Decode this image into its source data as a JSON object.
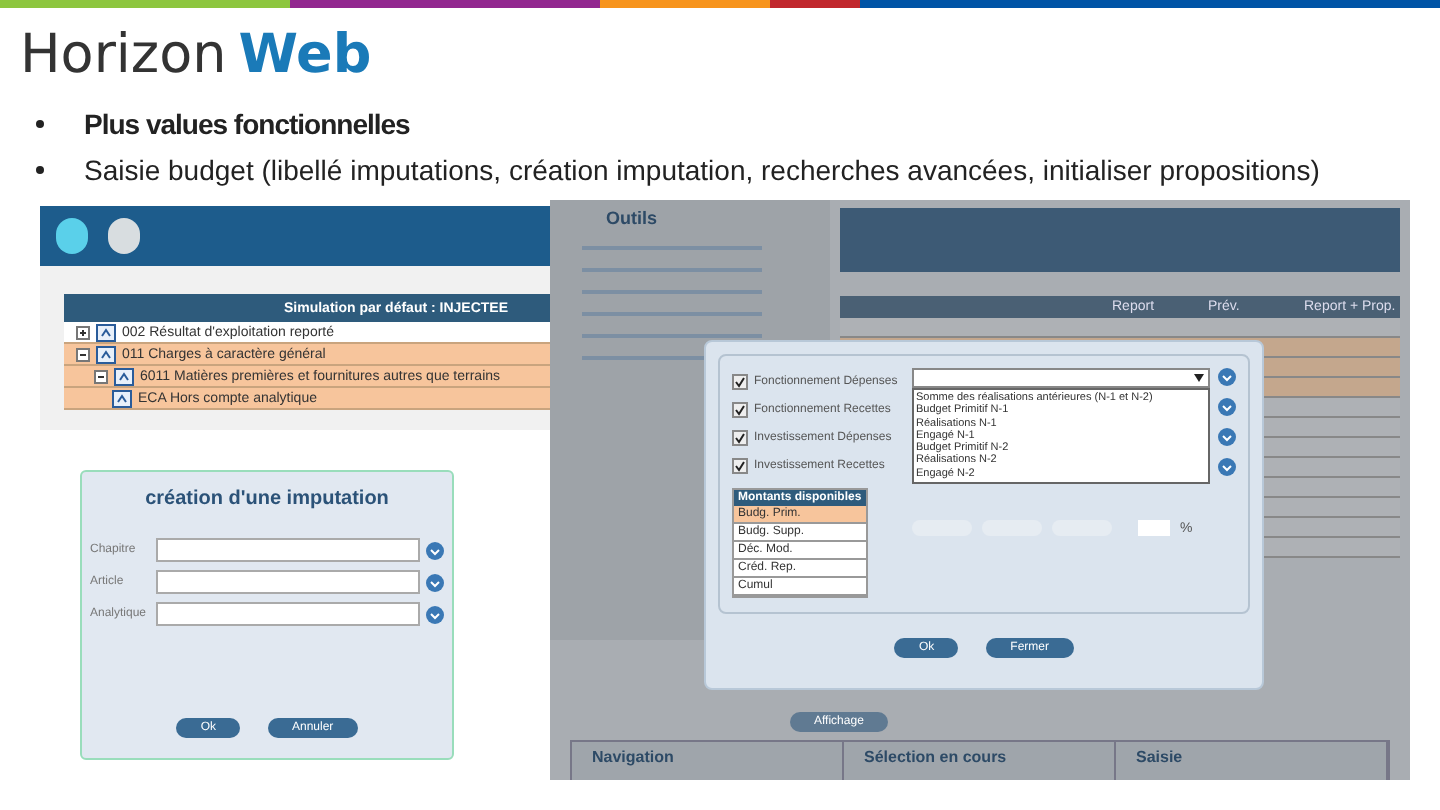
{
  "top_bar": [
    {
      "color": "#8dc63f"
    },
    {
      "color": "#92278f"
    },
    {
      "color": "#f7941d"
    },
    {
      "color": "#c1272d"
    },
    {
      "color": "#0054a6"
    }
  ],
  "logo": {
    "text": "Horizon",
    "accent": "Web"
  },
  "bullets": [
    {
      "text": "Plus values fonctionnelles",
      "bold": true
    },
    {
      "text": "Saisie budget (libellé imputations, création imputation, recherches avancées, initialiser propositions)",
      "bold": false
    }
  ],
  "tree_screenshot": {
    "header": "Simulation par défaut : INJECTEE",
    "rows": [
      {
        "label": "002 Résultat d'exploitation reporté",
        "kind": "chapter",
        "expanded": false,
        "highlighted": false
      },
      {
        "label": "011 Charges à caractère général",
        "kind": "chapter",
        "expanded": true,
        "highlighted": true,
        "children": [
          {
            "label": "6011 Matières premières et fournitures autres que terrains",
            "kind": "article",
            "expanded": true,
            "highlighted": true,
            "children": [
              {
                "label": "ECA Hors compte analytique",
                "kind": "analytic",
                "highlighted": true
              }
            ]
          }
        ]
      }
    ]
  },
  "imputation_dialog": {
    "title": "création d'une imputation",
    "fields": [
      {
        "label": "Chapitre"
      },
      {
        "label": "Article"
      },
      {
        "label": "Analytique"
      }
    ],
    "buttons": [
      "Ok",
      "Annuler"
    ]
  },
  "proposals_screenshot": {
    "menu_title": "Outils",
    "columns": [
      "Report",
      "Prév.",
      "Report + Prop."
    ],
    "dialog": {
      "checkboxes": [
        {
          "label": "Fonctionnement Dépenses",
          "checked": true
        },
        {
          "label": "Fonctionnement Recettes",
          "checked": true
        },
        {
          "label": "Investissement Dépenses",
          "checked": true
        },
        {
          "label": "Investissement Recettes",
          "checked": true
        }
      ],
      "dropdown_options": [
        "Somme des réalisations antérieures (N-1 et N-2)",
        "Budget Primitif N-1",
        "Réalisations N-1",
        "Engagé N-1",
        "Budget Primitif N-2",
        "Réalisations N-2",
        "Engagé N-2"
      ],
      "amounts_title": "Montants disponibles",
      "amounts": [
        {
          "label": "Budg. Prim.",
          "selected": true
        },
        {
          "label": "Budg. Supp.",
          "selected": false
        },
        {
          "label": "Déc. Mod.",
          "selected": false
        },
        {
          "label": "Créd. Rep.",
          "selected": false
        },
        {
          "label": "Cumul",
          "selected": false
        }
      ],
      "percent_sign": "%",
      "buttons": [
        "Ok",
        "Fermer"
      ]
    },
    "bottom_button": "Affichage",
    "panels": [
      "Navigation",
      "Sélection en cours",
      "Saisie"
    ]
  }
}
